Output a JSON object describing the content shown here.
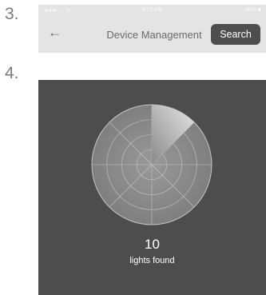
{
  "steps": {
    "first": "3.",
    "second": "4."
  },
  "status_bar": {
    "signal": "●●●○○ ᯤ",
    "time": "9:12 AM",
    "battery": "50% ■"
  },
  "nav": {
    "back_icon": "back-arrow-icon",
    "title": "Device Management",
    "search_label": "Search"
  },
  "radar": {
    "count": "10",
    "label": "lights found",
    "sweep_fraction": 0.125
  },
  "colors": {
    "nav_bg": "#e4e4e4",
    "search_btn_bg": "#4e4e4e",
    "panel_bg": "#4d4d4d",
    "radar_disc": "#8f8f8f"
  }
}
